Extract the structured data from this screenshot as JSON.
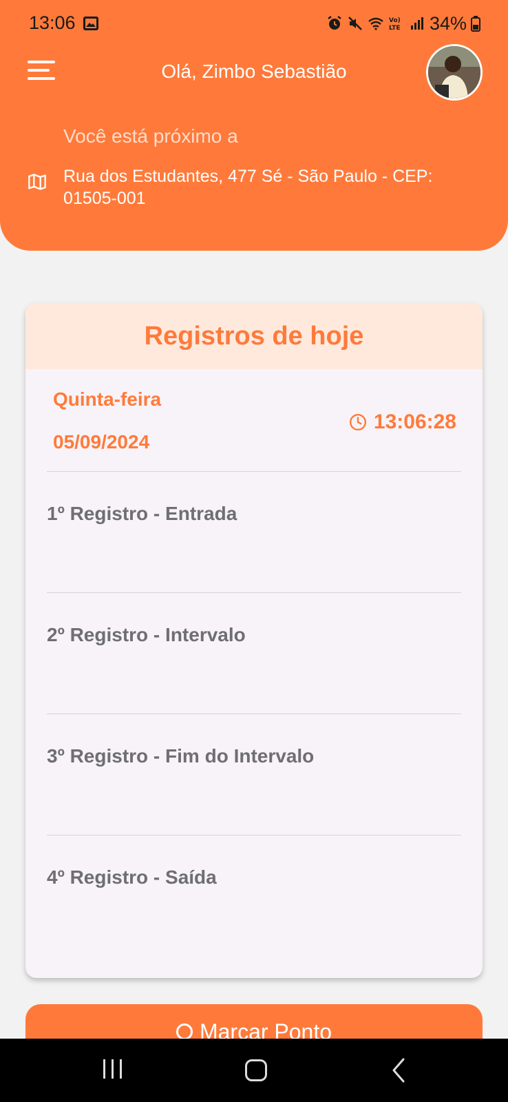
{
  "status_bar": {
    "time": "13:06",
    "battery": "34%",
    "icons": [
      "image-icon",
      "alarm-icon",
      "mute-icon",
      "wifi-icon",
      "volte-icon",
      "signal-icon",
      "battery-icon"
    ]
  },
  "header": {
    "greeting": "Olá, Zimbo Sebastião",
    "near_label": "Você está próximo a",
    "address": "Rua dos Estudantes, 477 Sé - São Paulo - CEP: 01505-001"
  },
  "card": {
    "title": "Registros de hoje",
    "weekday": "Quinta-feira",
    "date": "05/09/2024",
    "time": "13:06:28",
    "records": [
      {
        "label": "1º Registro - Entrada"
      },
      {
        "label": "2º Registro - Intervalo"
      },
      {
        "label": "3º Registro - Fim do Intervalo"
      },
      {
        "label": "4º Registro - Saída"
      }
    ]
  },
  "action": {
    "mark_label": "Marcar Ponto"
  },
  "colors": {
    "accent": "#ff7a3a",
    "card_header_bg": "#ffe9dd",
    "record_text": "#6e6e74"
  }
}
